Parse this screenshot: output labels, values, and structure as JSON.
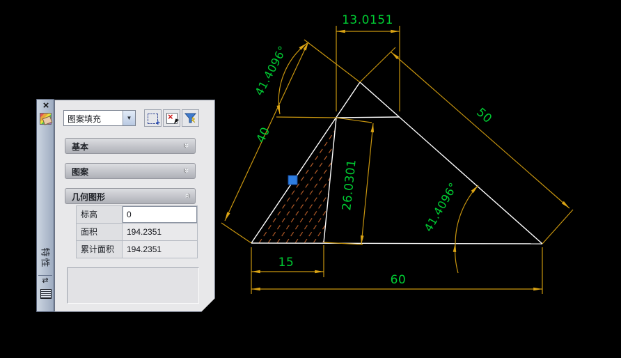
{
  "palette": {
    "title": "特性",
    "icons": {
      "close_glyph": "×",
      "combo_arrow_glyph": "▼",
      "chevron_glyph": "»",
      "autohide_glyph": "⇄",
      "deselect_x_glyph": "×"
    },
    "selector": {
      "value": "图案填充"
    },
    "toolbar_icons": [
      "select-new-object",
      "remove-from-selection",
      "quick-select"
    ],
    "sections": [
      {
        "label": "基本",
        "state": "collapsed"
      },
      {
        "label": "图案",
        "state": "collapsed"
      },
      {
        "label": "几何图形",
        "state": "expanded"
      }
    ],
    "properties": [
      {
        "label": "标高",
        "value": "0"
      },
      {
        "label": "面积",
        "value": "194.2351"
      },
      {
        "label": "累计面积",
        "value": "194.2351"
      }
    ]
  },
  "drawing": {
    "colors": {
      "geometry_line": "#ffffff",
      "dimension_line": "#c9960f",
      "dimension_text": "#00cc33",
      "hatch": "#b05a28",
      "grip": "#2e7de0",
      "background": "#000000"
    },
    "dimensions": {
      "top_width": "13.0151",
      "left_angle": "41.4096°",
      "left_edge": "40",
      "right_edge": "50",
      "inner_height": "26.0301",
      "right_angle": "41.4096°",
      "base_left": "15",
      "base_total": "60"
    }
  }
}
